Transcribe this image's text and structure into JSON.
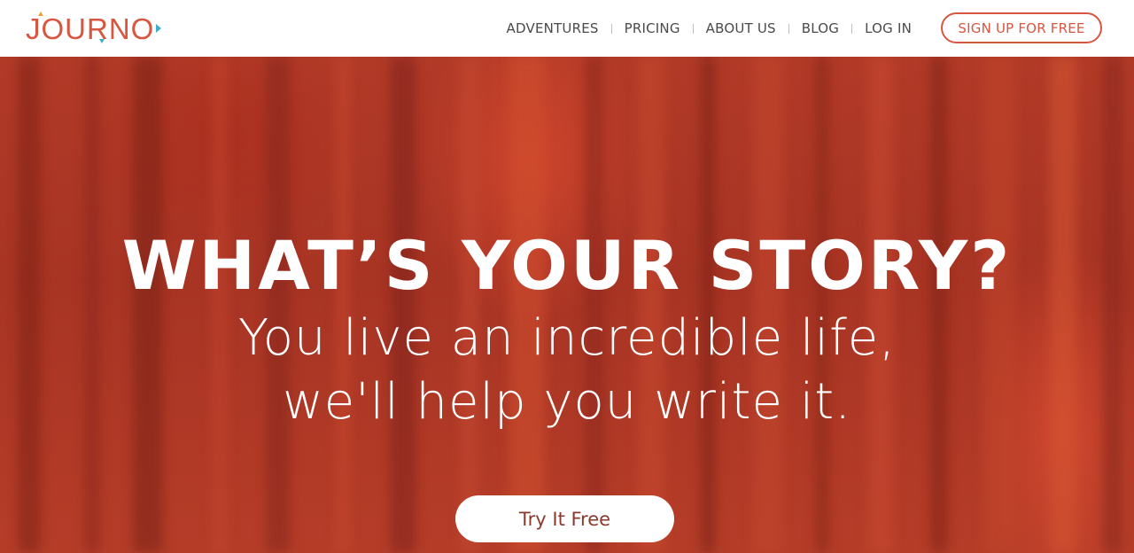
{
  "brand": {
    "name": "JOURNO",
    "primary_color": "#d8553f",
    "accent_color": "#3fb0c9"
  },
  "nav": {
    "items": [
      {
        "label": "ADVENTURES"
      },
      {
        "label": "PRICING"
      },
      {
        "label": "ABOUT US"
      },
      {
        "label": "BLOG"
      },
      {
        "label": "LOG IN"
      }
    ],
    "signup_label": "SIGN UP FOR FREE"
  },
  "hero": {
    "title": "WHAT’S YOUR STORY?",
    "subtitle_line1": "You live an incredible life,",
    "subtitle_line2": "we'll help you write it.",
    "cta_label": "Try It Free",
    "background_color": "#b13a27"
  }
}
